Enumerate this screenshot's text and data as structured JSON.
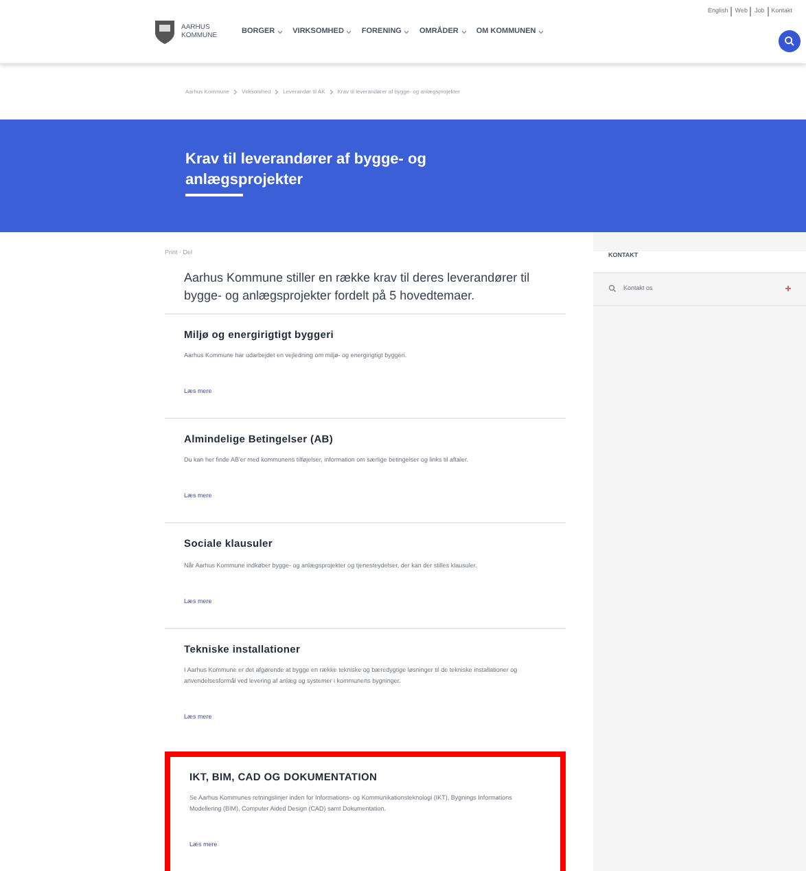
{
  "header": {
    "logo_text": "AARHUS KOMMUNE",
    "nav": [
      {
        "label": "BORGER"
      },
      {
        "label": "VIRKSOMHED"
      },
      {
        "label": "FORENING"
      },
      {
        "label": "OMRÅDER"
      },
      {
        "label": "OM KOMMUNEN"
      }
    ],
    "top_links": [
      "English",
      "Web",
      "Job",
      "Kontakt"
    ]
  },
  "breadcrumb": [
    "Aarhus Kommune",
    "Virksomhed",
    "Leverandør til AK",
    "Krav til leverandører af bygge- og anlægsprojekter"
  ],
  "banner": {
    "title": "Krav til leverandører af bygge- og anlægsprojekter"
  },
  "meta": "Print · Del",
  "intro": "Aarhus Kommune stiller en række krav til deres leverandører til bygge- og anlægsprojekter fordelt på 5 hovedtemaer.",
  "sections": [
    {
      "title": "Miljø og energirigtigt byggeri",
      "text": "Aarhus Kommune har udarbejdet en vejledning om miljø- og energirigtigt byggeri.",
      "link": "Læs mere",
      "highlighted": false
    },
    {
      "title": "Almindelige Betingelser (AB)",
      "text": "Du kan her finde AB'er med kommunens tilføjelser, information om særlige betingelser og links til aftaler.",
      "link": "Læs mere",
      "highlighted": false
    },
    {
      "title": "Sociale klausuler",
      "text": "Når Aarhus Kommune indkøber bygge- og anlægsprojekter og tjenesteydelser, der kan der stilles klausuler.",
      "link": "Læs mere",
      "highlighted": false
    },
    {
      "title": "Tekniske installationer",
      "text": "I Aarhus Kommune er det afgørende at bygge en række tekniske og bæredygtige løsninger til de tekniske installationer og anvendelsesformål ved levering af anlæg og systemer i kommunens bygninger.",
      "link": "Læs mere",
      "highlighted": false
    },
    {
      "title": "IKT, BIM, CAD OG DOKUMENTATION",
      "text": "Se Aarhus Kommunes retningslinjer inden for Informations- og Kommunikationsteknologi (IKT), Bygnings Informations Modellering (BIM), Computer Aided Design (CAD) samt Dokumentation.",
      "link": "Læs mere",
      "highlighted": true
    }
  ],
  "sidebar": {
    "heading": "KONTAKT",
    "item": "Kontakt os"
  }
}
